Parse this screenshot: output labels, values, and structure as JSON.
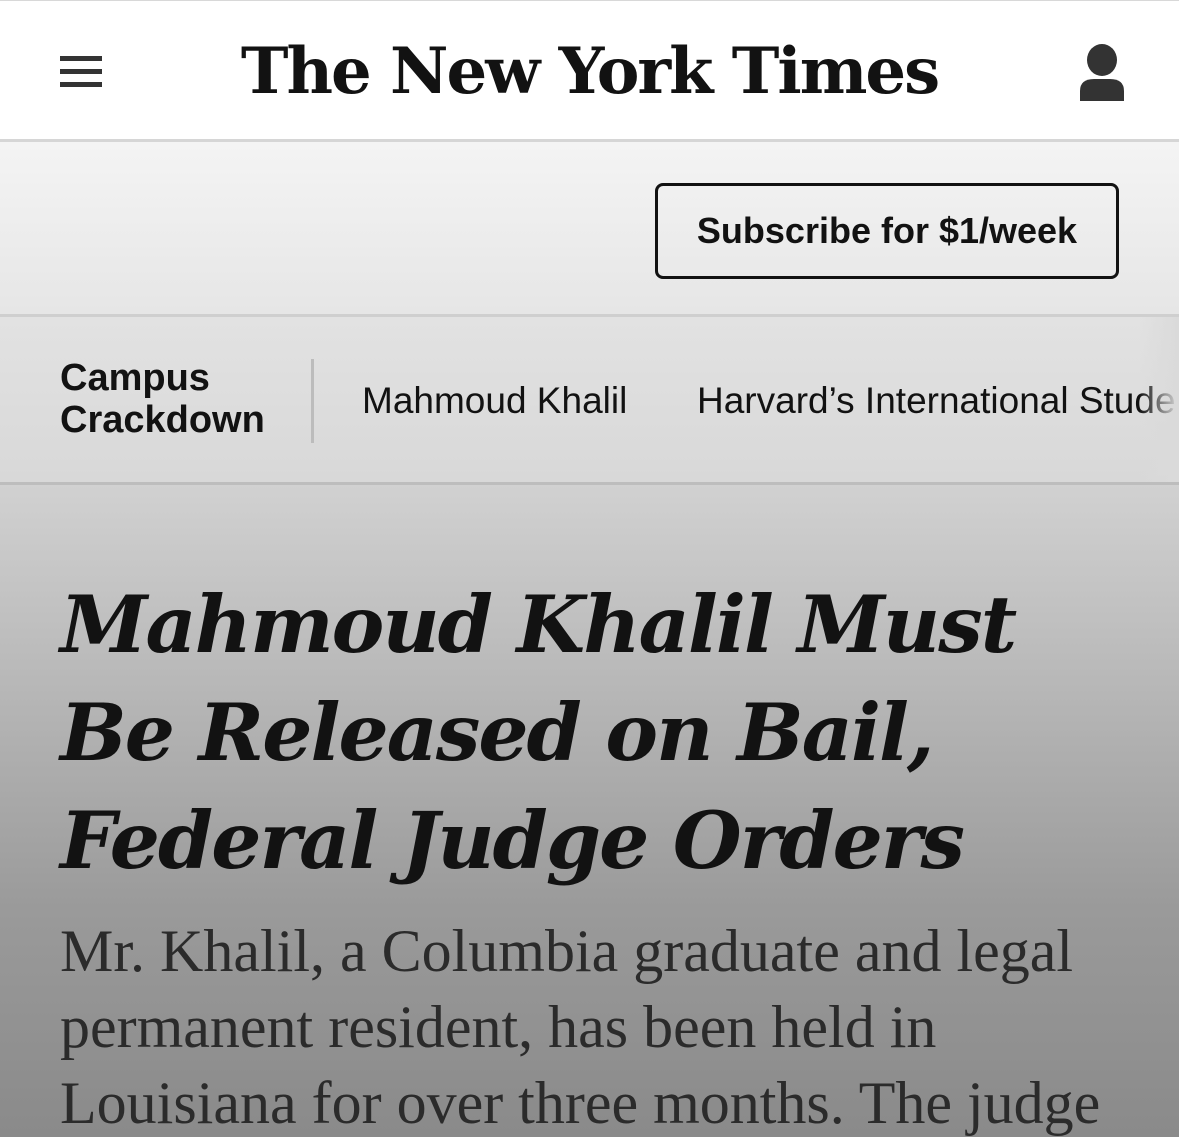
{
  "header": {
    "menu_icon": "hamburger-menu-icon",
    "logo_text": "The New York Times",
    "account_icon": "person-icon"
  },
  "subscribe": {
    "label": "Subscribe for $1/week"
  },
  "section_nav": {
    "title_line1": "Campus",
    "title_line2": "Crackdown",
    "links": [
      {
        "label": "Mahmoud Khalil"
      },
      {
        "label": "Harvard’s International Stude"
      }
    ]
  },
  "article": {
    "headline_lines": [
      "Mahmoud Khalil Must",
      "Be Released on Bail,",
      "Federal Judge Orders"
    ],
    "summary_lines": [
      "Mr. Khalil, a Columbia graduate and legal",
      "permanent resident, has been held in",
      "Louisiana for over three months. The judge"
    ]
  },
  "colors": {
    "text": "#121212",
    "header_bg": "#ffffff",
    "subscribe_bar_bg": "#eeeeee",
    "nav_bg": "#dddddd"
  }
}
